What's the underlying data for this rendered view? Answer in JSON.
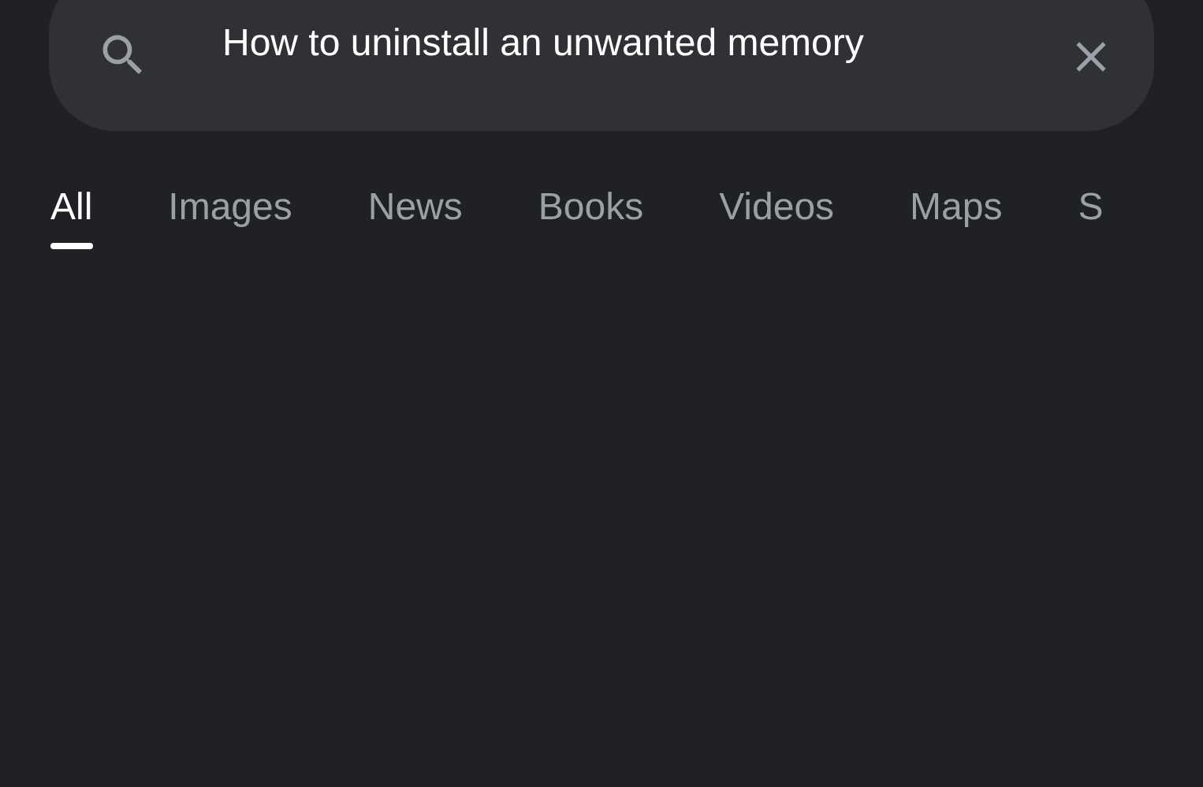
{
  "search": {
    "value": "How to uninstall an unwanted memory"
  },
  "tabs": [
    {
      "label": "All",
      "selected": true
    },
    {
      "label": "Images",
      "selected": false
    },
    {
      "label": "News",
      "selected": false
    },
    {
      "label": "Books",
      "selected": false
    },
    {
      "label": "Videos",
      "selected": false
    },
    {
      "label": "Maps",
      "selected": false
    },
    {
      "label": "S",
      "selected": false
    }
  ]
}
